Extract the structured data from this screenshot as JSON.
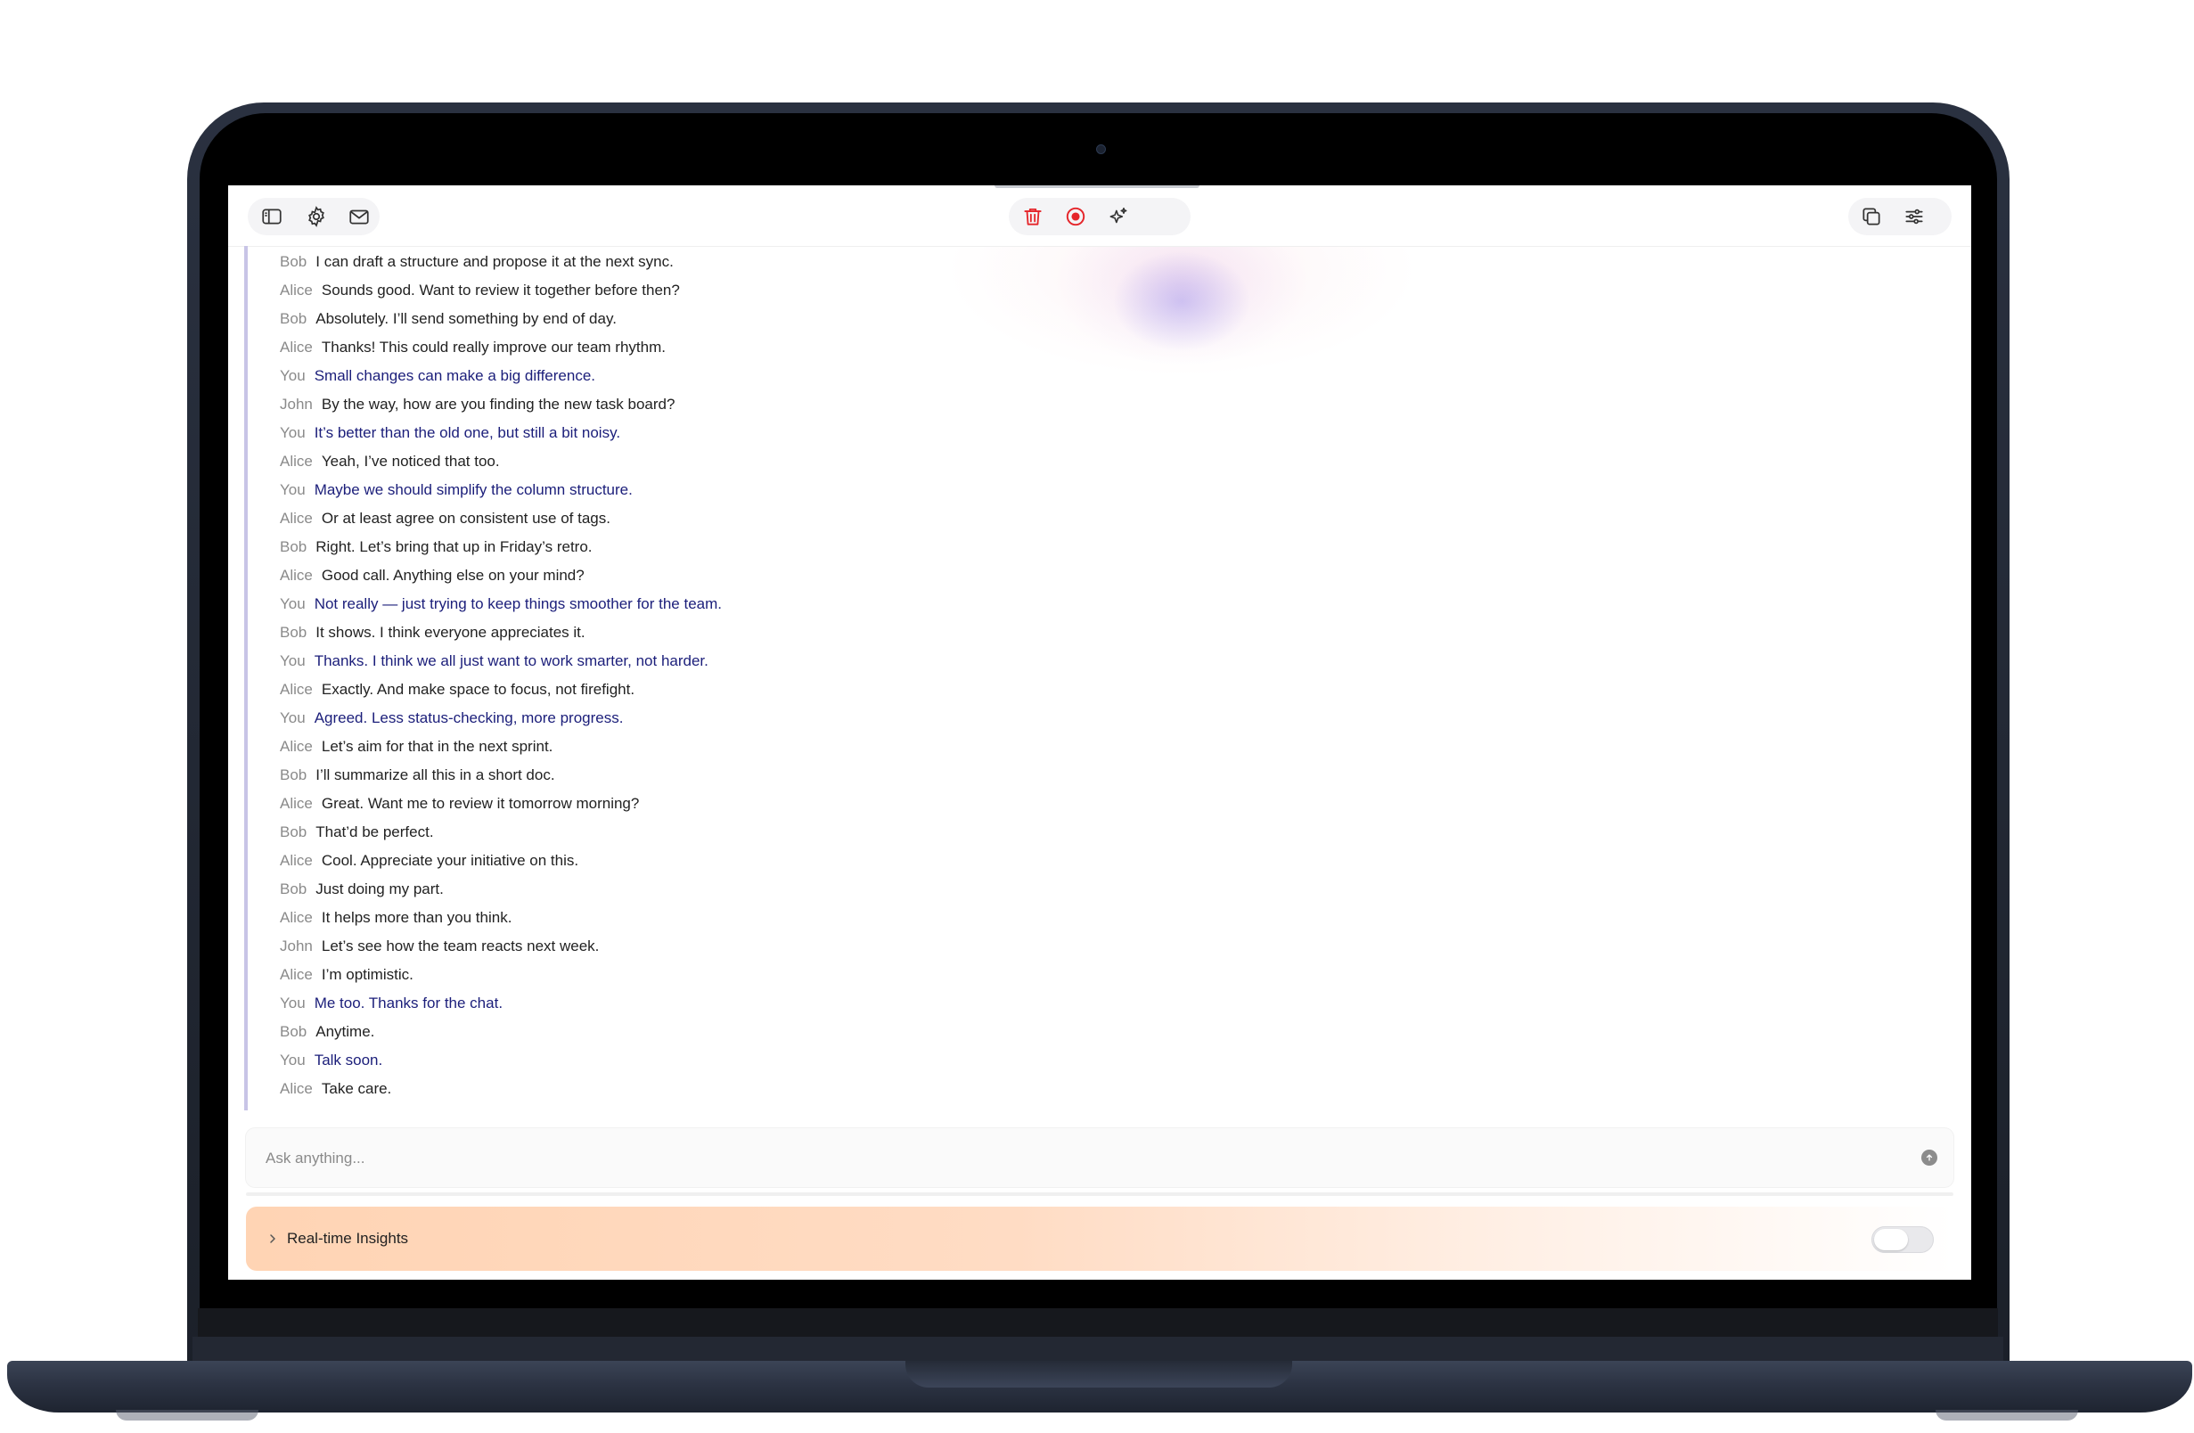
{
  "toolbar": {
    "left_icons": [
      "sidebar-icon",
      "settings-icon",
      "mail-icon"
    ],
    "center_icons": [
      "trash-icon",
      "record-icon",
      "sparkle-icon"
    ],
    "right_icons": [
      "copy-icon",
      "sliders-icon"
    ],
    "colors": {
      "danger": "#e5252a",
      "icon": "#333333"
    }
  },
  "transcript": [
    {
      "speaker": "Bob",
      "text": "I can draft a structure and propose it at the next sync."
    },
    {
      "speaker": "Alice",
      "text": "Sounds good. Want to review it together before then?"
    },
    {
      "speaker": "Bob",
      "text": "Absolutely. I’ll send something by end of day."
    },
    {
      "speaker": "Alice",
      "text": "Thanks! This could really improve our team rhythm."
    },
    {
      "speaker": "You",
      "text": "Small changes can make a big difference."
    },
    {
      "speaker": "John",
      "text": "By the way, how are you finding the new task board?"
    },
    {
      "speaker": "You",
      "text": "It’s better than the old one, but still a bit noisy."
    },
    {
      "speaker": "Alice",
      "text": "Yeah, I’ve noticed that too."
    },
    {
      "speaker": "You",
      "text": "Maybe we should simplify the column structure."
    },
    {
      "speaker": "Alice",
      "text": "Or at least agree on consistent use of tags."
    },
    {
      "speaker": "Bob",
      "text": "Right. Let’s bring that up in Friday’s retro."
    },
    {
      "speaker": "Alice",
      "text": "Good call. Anything else on your mind?"
    },
    {
      "speaker": "You",
      "text": "Not really — just trying to keep things smoother for the team."
    },
    {
      "speaker": "Bob",
      "text": "It shows. I think everyone appreciates it."
    },
    {
      "speaker": "You",
      "text": "Thanks. I think we all just want to work smarter, not harder."
    },
    {
      "speaker": "Alice",
      "text": "Exactly. And make space to focus, not firefight."
    },
    {
      "speaker": "You",
      "text": "Agreed. Less status-checking, more progress."
    },
    {
      "speaker": "Alice",
      "text": "Let’s aim for that in the next sprint."
    },
    {
      "speaker": "Bob",
      "text": "I’ll summarize all this in a short doc."
    },
    {
      "speaker": "Alice",
      "text": "Great. Want me to review it tomorrow morning?"
    },
    {
      "speaker": "Bob",
      "text": "That’d be perfect."
    },
    {
      "speaker": "Alice",
      "text": "Cool. Appreciate your initiative on this."
    },
    {
      "speaker": "Bob",
      "text": "Just doing my part."
    },
    {
      "speaker": "Alice",
      "text": "It helps more than you think."
    },
    {
      "speaker": "John",
      "text": "Let’s see how the team reacts next week."
    },
    {
      "speaker": "Alice",
      "text": "I’m optimistic."
    },
    {
      "speaker": "You",
      "text": "Me too. Thanks for the chat."
    },
    {
      "speaker": "Bob",
      "text": "Anytime."
    },
    {
      "speaker": "You",
      "text": "Talk soon."
    },
    {
      "speaker": "Alice",
      "text": "Take care."
    }
  ],
  "ask": {
    "placeholder": "Ask anything..."
  },
  "insights": {
    "label": "Real-time Insights",
    "toggle_on": false
  }
}
